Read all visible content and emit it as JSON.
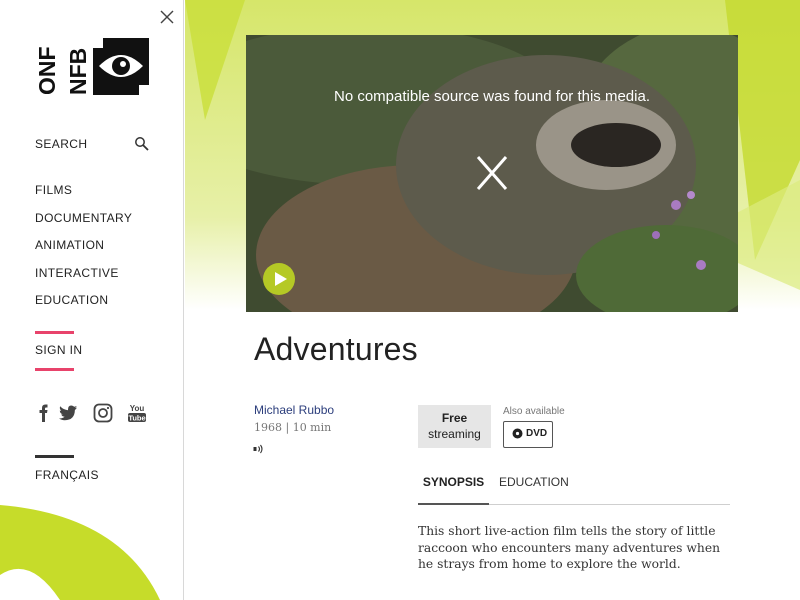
{
  "sidebar": {
    "logo": {
      "text_left": "ONF",
      "text_right": "NFB"
    },
    "search_label": "SEARCH",
    "nav_items": [
      "FILMS",
      "DOCUMENTARY",
      "ANIMATION",
      "INTERACTIVE",
      "EDUCATION"
    ],
    "signin_label": "SIGN IN",
    "socials": [
      "facebook",
      "twitter",
      "instagram",
      "youtube"
    ],
    "language_label": "FRANÇAIS",
    "icons": {
      "close": "close-icon",
      "search": "search-icon"
    }
  },
  "player": {
    "message": "No compatible source was found for this media.",
    "error_glyph": "X",
    "play_icon": "play-icon"
  },
  "film": {
    "title": "Adventures",
    "director": "Michael Rubbo",
    "meta": "1968 | 10 min",
    "audio_icon": "audio-description-icon"
  },
  "availability": {
    "free_line1": "Free",
    "free_line2": "streaming",
    "also_available": "Also available",
    "dvd_label": "DVD"
  },
  "tabs": [
    "SYNOPSIS",
    "EDUCATION"
  ],
  "synopsis": "This short live-action film tells the story of little raccoon who encounters many adventures when he strays from home to explore the world.",
  "colors": {
    "accent_green": "#c6dc2a",
    "accent_pink": "#e8436b",
    "link_blue": "#2c3e7c"
  }
}
